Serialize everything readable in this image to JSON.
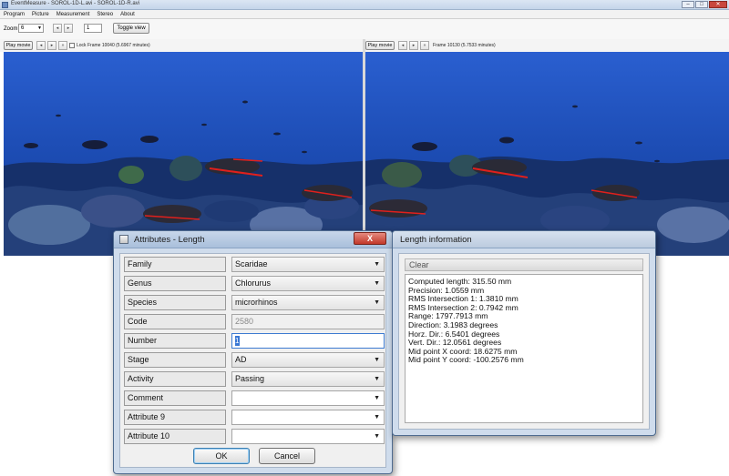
{
  "window": {
    "title": "EventMeasure - SOROL-1D-L.avi - SOROL-1D-R.avi"
  },
  "menu": [
    "Program",
    "Picture",
    "Measurement",
    "Stereo",
    "About"
  ],
  "toolbar": {
    "zoom_label": "Zoom",
    "zoom_value": "6",
    "step_value": "1",
    "toggle_label": "Toggle view"
  },
  "left_view": {
    "play_label": "Play movie",
    "lock_label": "Lock",
    "frame_text": "Frame 10040 (5.6967 minutes)"
  },
  "right_view": {
    "play_label": "Play movie",
    "frame_text": "Frame 10130 (5.7533 minutes)"
  },
  "attributes_dialog": {
    "title": "Attributes - Length",
    "close_label": "X",
    "fields": [
      {
        "label": "Family",
        "value": "Scaridae",
        "kind": "combo"
      },
      {
        "label": "Genus",
        "value": "Chlorurus",
        "kind": "combo"
      },
      {
        "label": "Species",
        "value": "microrhinos",
        "kind": "combo"
      },
      {
        "label": "Code",
        "value": "2580",
        "kind": "disabled"
      },
      {
        "label": "Number",
        "value": "1",
        "kind": "text"
      },
      {
        "label": "Stage",
        "value": "AD",
        "kind": "combo"
      },
      {
        "label": "Activity",
        "value": "Passing",
        "kind": "combo"
      },
      {
        "label": "Comment",
        "value": "",
        "kind": "dropdown"
      },
      {
        "label": "Attribute 9",
        "value": "",
        "kind": "dropdown"
      },
      {
        "label": "Attribute 10",
        "value": "",
        "kind": "dropdown"
      }
    ],
    "ok_label": "OK",
    "cancel_label": "Cancel"
  },
  "length_dialog": {
    "title": "Length information",
    "clear_label": "Clear",
    "lines": [
      "Computed length: 315.50 mm",
      "Precision: 1.0559 mm",
      "RMS Intersection 1: 1.3810 mm",
      "RMS Intersection 2: 0.7942 mm",
      "Range: 1797.7913 mm",
      "Direction: 3.1983 degrees",
      "Horz. Dir.: 6.5401 degrees",
      "Vert. Dir.: 12.0561 degrees",
      "Mid point X coord: 18.6275 mm",
      "Mid point Y coord: -100.2576 mm"
    ]
  },
  "colors": {
    "water_top": "#1e4fb8",
    "water_bottom": "#0f2f6e",
    "measure_line": "#e0201c",
    "dialog_frame": "#cfdcec"
  }
}
